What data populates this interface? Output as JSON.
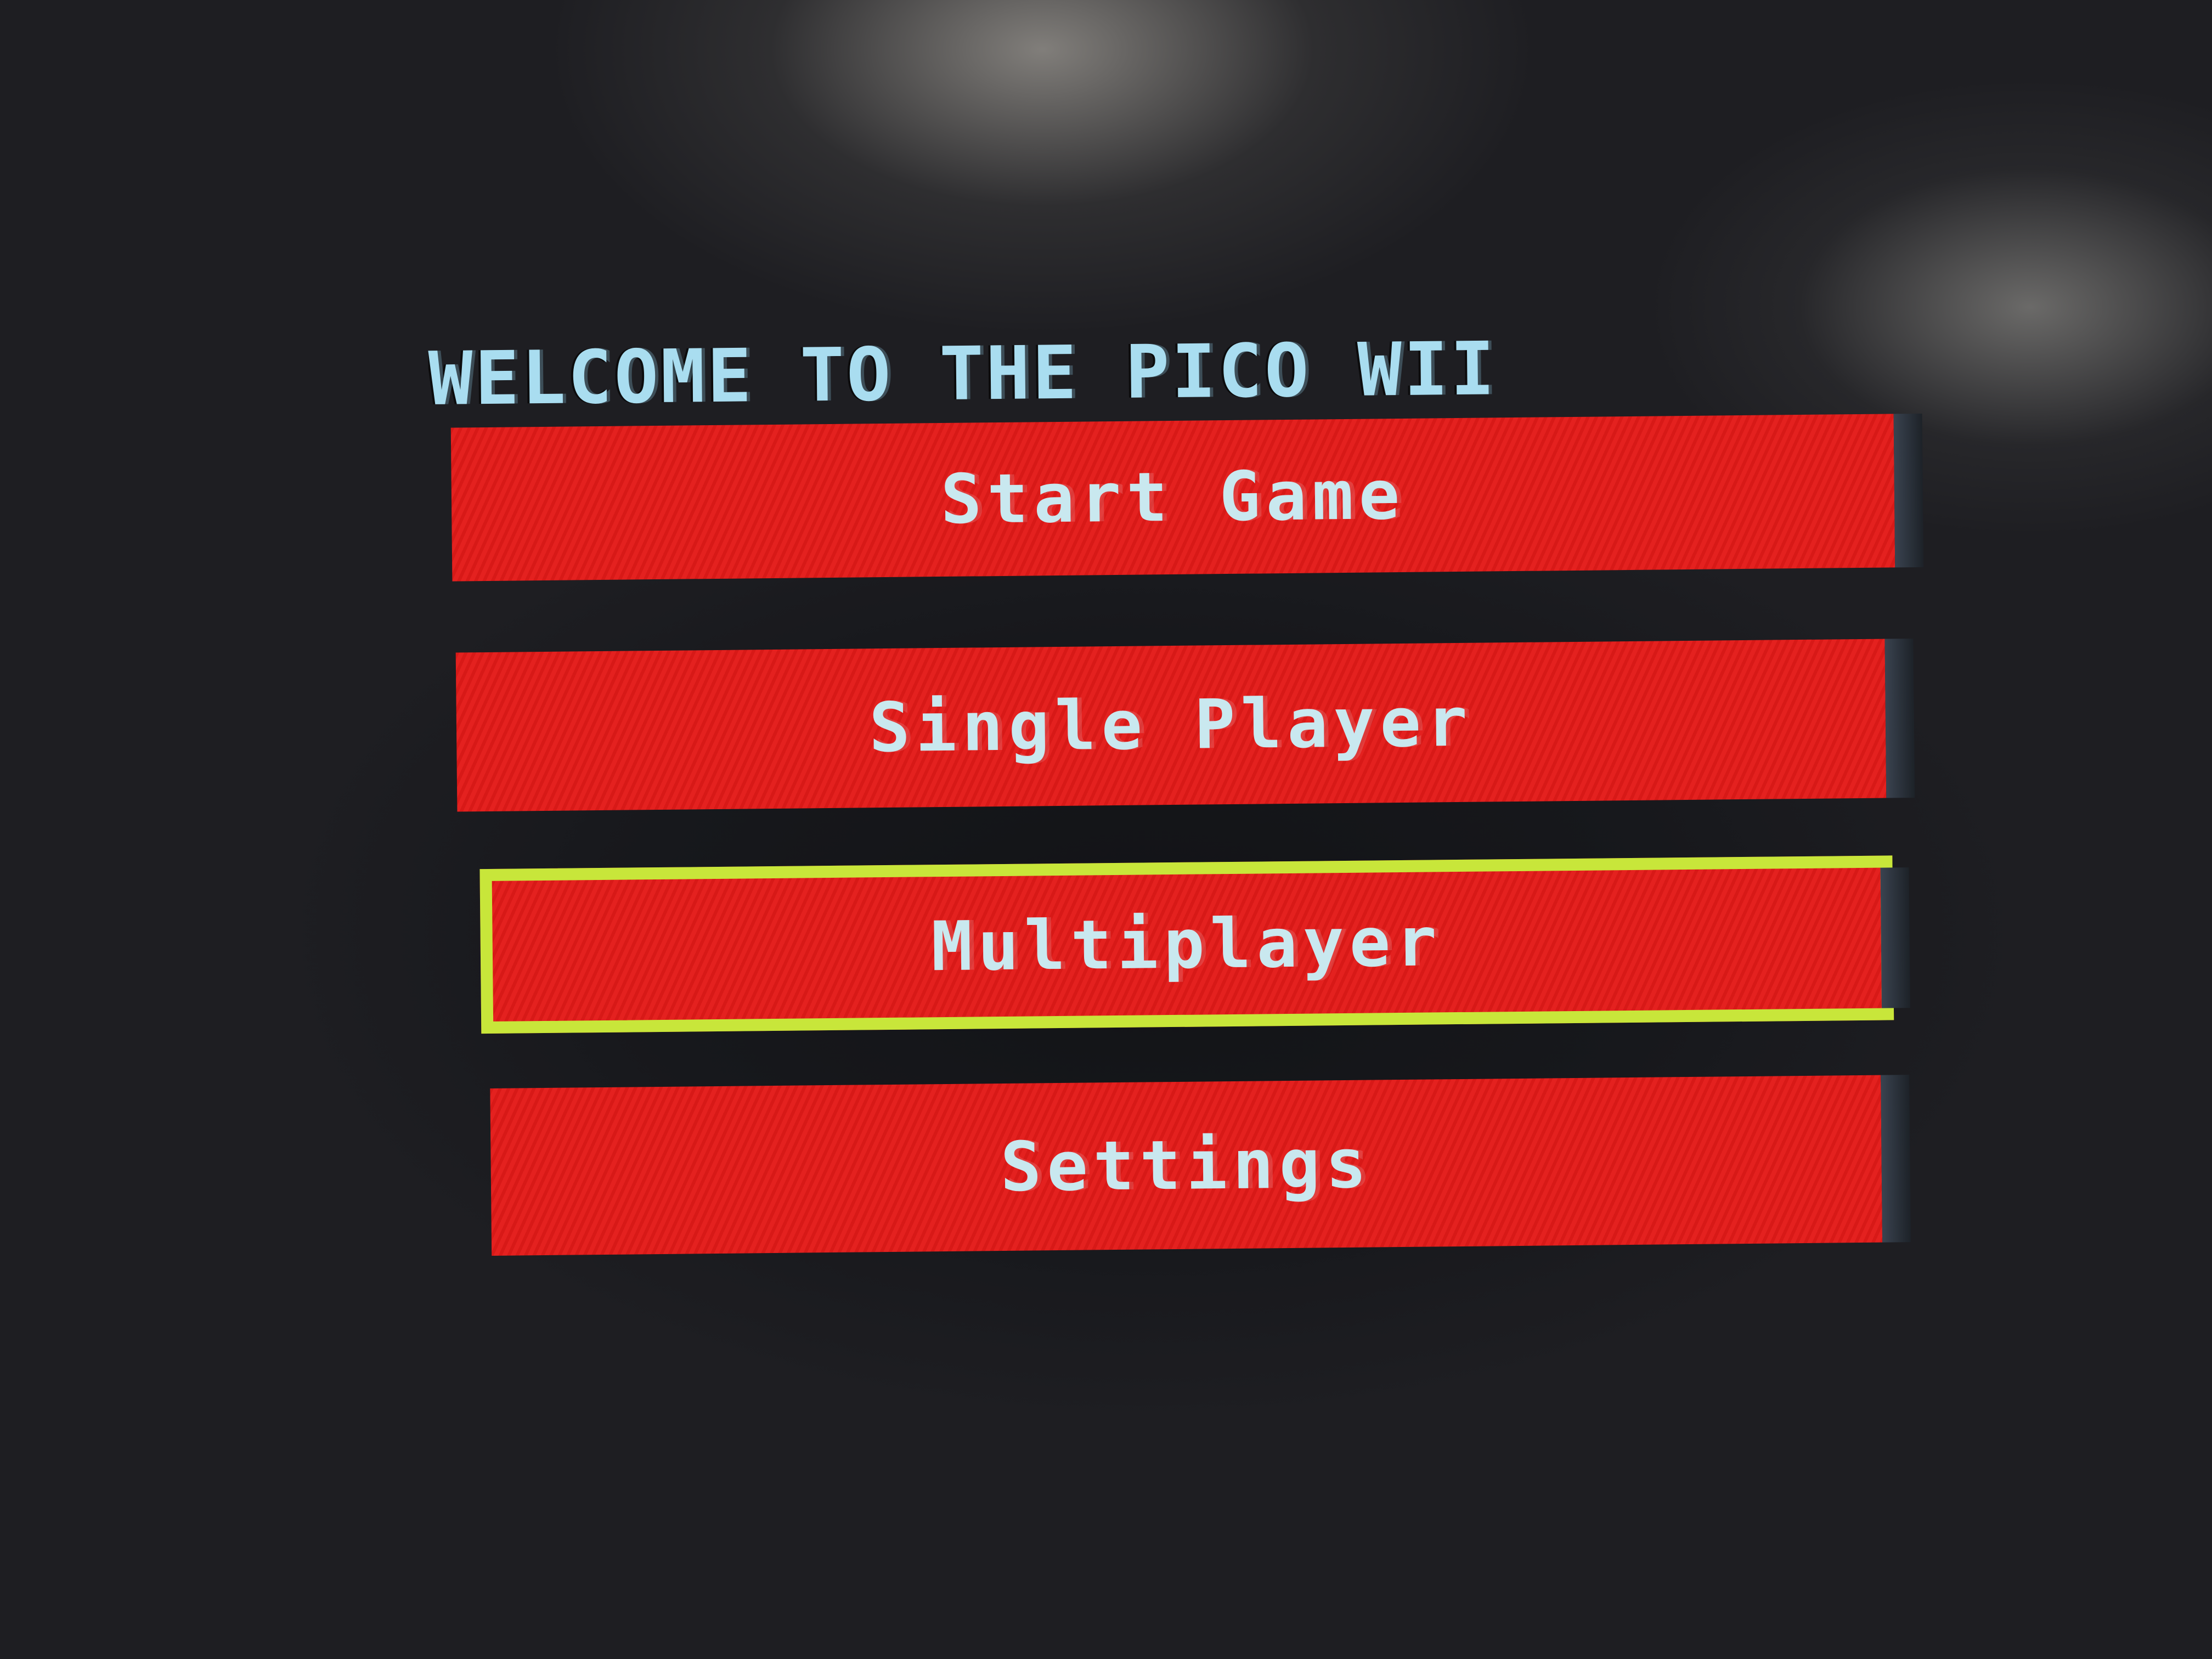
{
  "screen": {
    "title": "WELCOME TO THE PICO WII"
  },
  "menu": {
    "items": [
      {
        "label": "Start Game",
        "selected": false
      },
      {
        "label": "Single Player",
        "selected": false
      },
      {
        "label": "Multiplayer",
        "selected": true
      },
      {
        "label": "Settings",
        "selected": false
      }
    ]
  },
  "colors": {
    "button_fill": "#e31a18",
    "selection_border": "#c8e63a",
    "text": "#c9e8ef",
    "title_text": "#a9ddf0",
    "background": "#000000"
  }
}
